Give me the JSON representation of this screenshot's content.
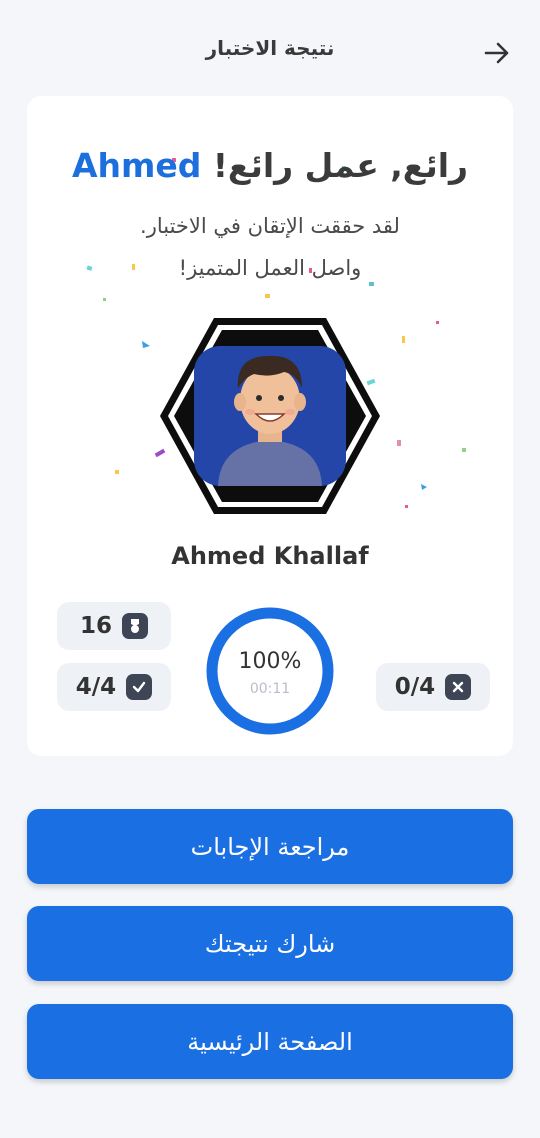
{
  "header": {
    "title": "نتيجة الاختبار",
    "back_icon": "arrow-right-icon"
  },
  "result": {
    "headline_prefix": "رائع, عمل رائع!",
    "headline_name": "Ahmed",
    "subtitle_line1": "لقد حققت الإتقان في الاختبار.",
    "subtitle_line2": "واصل العمل المتميز!",
    "user_name": "Ahmed Khallaf",
    "points": "16",
    "correct": "4/4",
    "wrong": "0/4",
    "percent": "100%",
    "time": "00:11",
    "progress": 1.0
  },
  "buttons": {
    "review": "مراجعة الإجابات",
    "share": "شارك نتيجتك",
    "home": "الصفحة الرئيسية"
  },
  "colors": {
    "primary": "#1a6fe2",
    "name_accent": "#1e6fde",
    "card_bg": "#ffffff",
    "page_bg": "#f4f6fa",
    "pill_bg": "#eef1f6"
  }
}
